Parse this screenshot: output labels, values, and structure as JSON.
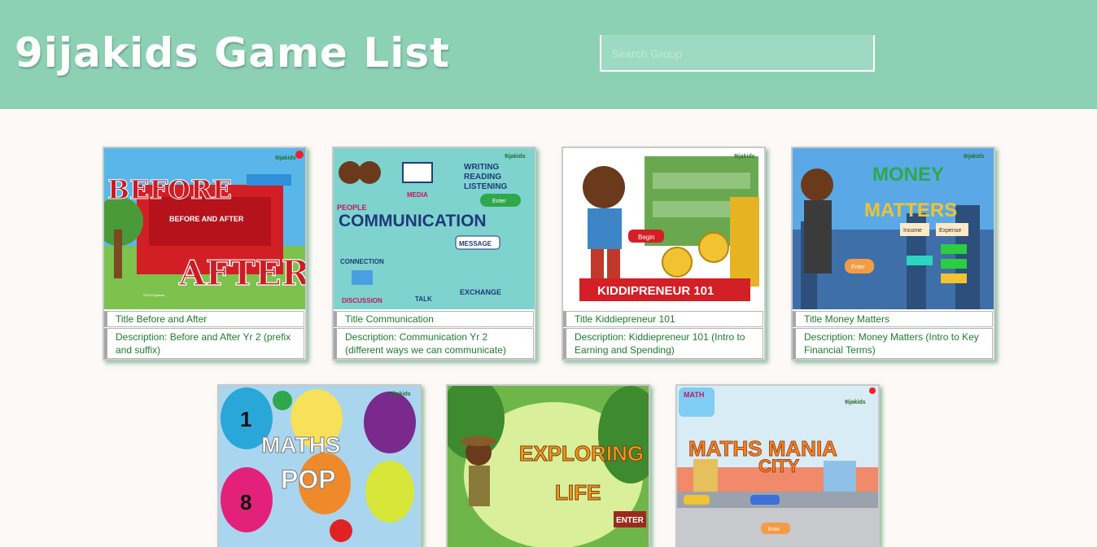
{
  "header": {
    "title": "9ijakids Game List",
    "search_placeholder": "Search Group"
  },
  "colors": {
    "header_bg": "#8dd1b5",
    "text_green": "#1f7a2e",
    "page_bg": "#fdf9f7"
  },
  "games": [
    {
      "title_prefix": "Title",
      "title": "Before and After",
      "desc_prefix": "Description:",
      "description": "Before and After Yr 2 (prefix and suffix)",
      "art_text": [
        "BEFORE",
        "AFTER",
        "BEFORE AND AFTER"
      ],
      "icon": "before-after-stage-thumbnail"
    },
    {
      "title_prefix": "Title",
      "title": "Communication",
      "desc_prefix": "Description:",
      "description": "Communication Yr 2 (different ways we can communicate)",
      "art_text": [
        "COMMUNICATION",
        "WRITING",
        "READING",
        "LISTENING",
        "PEOPLE",
        "MEDIA",
        "MESSAGE",
        "CONNECTION",
        "DISCUSSION",
        "TALK",
        "EXCHANGE",
        "Enter"
      ],
      "icon": "communication-thumbnail"
    },
    {
      "title_prefix": "Title",
      "title": "Kiddiepreneur 101",
      "desc_prefix": "Description:",
      "description": "Kiddiepreneur 101 (Intro to Earning and Spending)",
      "art_text": [
        "KIDDIPRENEUR 101",
        "Begin"
      ],
      "icon": "kiddiepreneur-thumbnail"
    },
    {
      "title_prefix": "Title",
      "title": "Money Matters",
      "desc_prefix": "Description:",
      "description": "Money Matters (Intro to Key Financial Terms)",
      "art_text": [
        "MONEY",
        "MATTERS",
        "Income",
        "Expense",
        "Enter"
      ],
      "icon": "money-matters-thumbnail"
    },
    {
      "art_text": [
        "MATHS",
        "POP",
        "1",
        "8"
      ],
      "icon": "maths-pop-thumbnail"
    },
    {
      "art_text": [
        "EXPLORING",
        "LIFE",
        "ENTER"
      ],
      "icon": "exploring-life-thumbnail"
    },
    {
      "art_text": [
        "MATHS MANIA",
        "CITY",
        "MATH",
        "Enter"
      ],
      "icon": "maths-mania-city-thumbnail"
    }
  ],
  "brand_badge": "9ijakids"
}
